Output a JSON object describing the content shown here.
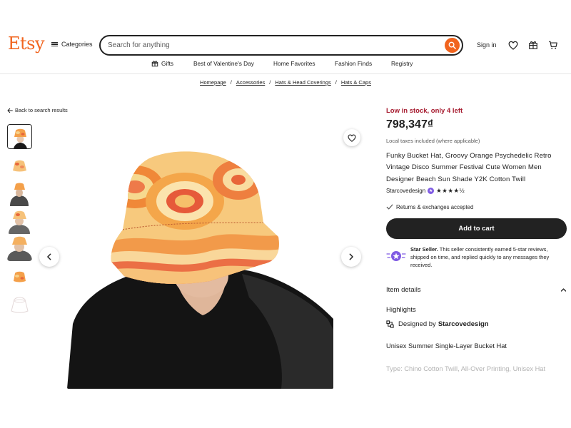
{
  "header": {
    "logo": "Etsy",
    "categories_label": "Categories",
    "search_placeholder": "Search for anything",
    "signin_label": "Sign in",
    "accent_color": "#f1641e"
  },
  "nav": {
    "items": [
      {
        "label": "Gifts",
        "icon": "gift-icon"
      },
      {
        "label": "Best of Valentine's Day"
      },
      {
        "label": "Home Favorites"
      },
      {
        "label": "Fashion Finds"
      },
      {
        "label": "Registry"
      }
    ]
  },
  "breadcrumb": {
    "items": [
      "Homepage",
      "Accessories",
      "Hats & Head Coverings",
      "Hats & Caps"
    ],
    "separator": "/"
  },
  "gallery": {
    "back_label": "Back to search results",
    "thumbnail_count": 7,
    "active_thumbnail": 1
  },
  "product": {
    "stock_message": "Low in stock, only 4 left",
    "price": "798,347₫",
    "taxes_note": "Local taxes included (where applicable)",
    "title": "Funky Bucket Hat, Groovy Orange Psychedelic Retro Vintage Disco Summer Festival Cute Women Men Designer Beach Sun Shade Y2K Cotton Twill",
    "shop_name": "Starcovedesign",
    "rating": 4.5,
    "returns_note": "Returns & exchanges accepted",
    "add_to_cart_label": "Add to cart",
    "star_seller_title": "Star Seller.",
    "star_seller_text": "This seller consistently earned 5-star reviews, shipped on time, and replied quickly to any messages they received.",
    "item_details_label": "Item details",
    "highlights_label": "Highlights",
    "designed_by_prefix": "Designed by",
    "designed_by_shop": "Starcovedesign",
    "description_line1": "Unisex Summer Single-Layer Bucket Hat",
    "description_line2": "Type: Chino Cotton Twill, All-Over Printing, Unisex Hat",
    "stock_color": "#a61a2e",
    "star_seller_color": "#7f5be3"
  }
}
